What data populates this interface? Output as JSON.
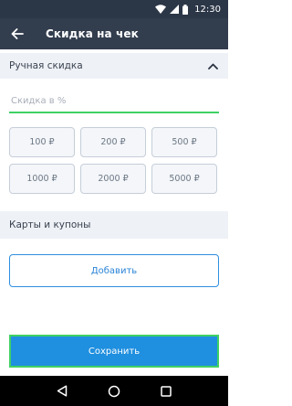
{
  "status_bar": {
    "time": "12:30",
    "icons": [
      "wifi-icon",
      "signal-icon",
      "battery-icon"
    ]
  },
  "app_bar": {
    "title": "Скидка на чек",
    "back_icon": "arrow-back-icon",
    "background": "#323d4e"
  },
  "manual_discount": {
    "title": "Ручная скидка",
    "collapse_icon": "chevron-up-icon",
    "input_placeholder": "Скидка в %",
    "input_value": "",
    "presets": [
      "100 ₽",
      "200 ₽",
      "500 ₽",
      "1000 ₽",
      "2000 ₽",
      "5000 ₽"
    ]
  },
  "cards_coupons": {
    "title": "Карты и купоны",
    "add_label": "Добавить"
  },
  "footer": {
    "save_label": "Сохранить"
  },
  "nav_bar": {
    "icons": [
      "back-triangle-icon",
      "home-circle-icon",
      "recents-square-icon"
    ]
  },
  "colors": {
    "accent": "#1f8fdf",
    "focus_green": "#3fd063",
    "section_bg": "#eef1f6"
  }
}
